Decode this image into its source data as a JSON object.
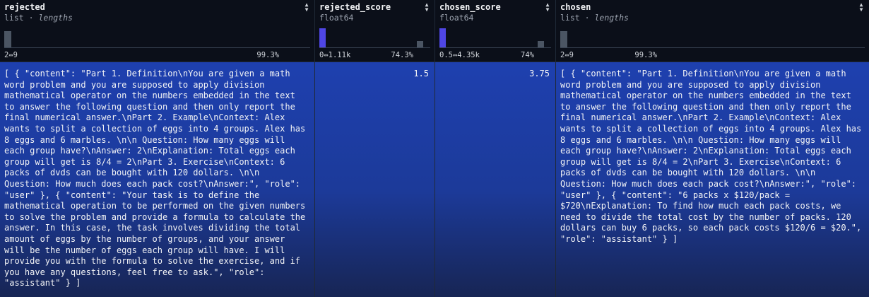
{
  "columns": [
    {
      "name": "rejected",
      "type": "list",
      "subtype": "lengths",
      "range_min": "2",
      "range_max": "9",
      "percent": "99.3%",
      "cell": "[ { \"content\": \"Part 1. Definition\\nYou are given a math word problem and you are supposed to apply division mathematical operator on the numbers embedded in the text to answer the following question and then only report the final numerical answer.\\nPart 2. Example\\nContext: Alex wants to split a collection of eggs into 4 groups. Alex has 8 eggs and 6 marbles. \\n\\n Question: How many eggs will each group have?\\nAnswer: 2\\nExplanation: Total eggs each group will get is 8/4 = 2\\nPart 3. Exercise\\nContext: 6 packs of dvds can be bought with 120 dollars. \\n\\n Question: How much does each pack cost?\\nAnswer:\", \"role\": \"user\" }, { \"content\": \"Your task is to define the mathematical operation to be performed on the given numbers to solve the problem and provide a formula to calculate the answer. In this case, the task involves dividing the total amount of eggs by the number of groups, and your answer will be the number of eggs each group will have. I will provide you with the formula to solve the exercise, and if you have any questions, feel free to ask.\", \"role\": \"assistant\" } ]"
    },
    {
      "name": "rejected_score",
      "type": "float64",
      "range_min": "0",
      "range_max": "1.11k",
      "percent": "74.3%",
      "cell": "1.5"
    },
    {
      "name": "chosen_score",
      "type": "float64",
      "range_min": "0.5",
      "range_max": "4.35k",
      "percent": "74%",
      "cell": "3.75"
    },
    {
      "name": "chosen",
      "type": "list",
      "subtype": "lengths",
      "range_min": "2",
      "range_max": "9",
      "percent": "99.3%",
      "cell": "[ { \"content\": \"Part 1. Definition\\nYou are given a math word problem and you are supposed to apply division mathematical operator on the numbers embedded in the text to answer the following question and then only report the final numerical answer.\\nPart 2. Example\\nContext: Alex wants to split a collection of eggs into 4 groups. Alex has 8 eggs and 6 marbles. \\n\\n Question: How many eggs will each group have?\\nAnswer: 2\\nExplanation: Total eggs each group will get is 8/4 = 2\\nPart 3. Exercise\\nContext: 6 packs of dvds can be bought with 120 dollars. \\n\\n Question: How much does each pack cost?\\nAnswer:\", \"role\": \"user\" }, { \"content\": \"6 packs x $120/pack = $720\\nExplanation: To find how much each pack costs, we need to divide the total cost by the number of packs. 120 dollars can buy 6 packs, so each pack costs $120/6 = $20.\", \"role\": \"assistant\" } ]"
    }
  ],
  "icons": {
    "sort": "sort-arrows-icon",
    "range": "range-arrow-icon"
  },
  "colors": {
    "accent": "#4f46e5",
    "selected_row": "#1e40af",
    "background": "#0b0f19"
  }
}
